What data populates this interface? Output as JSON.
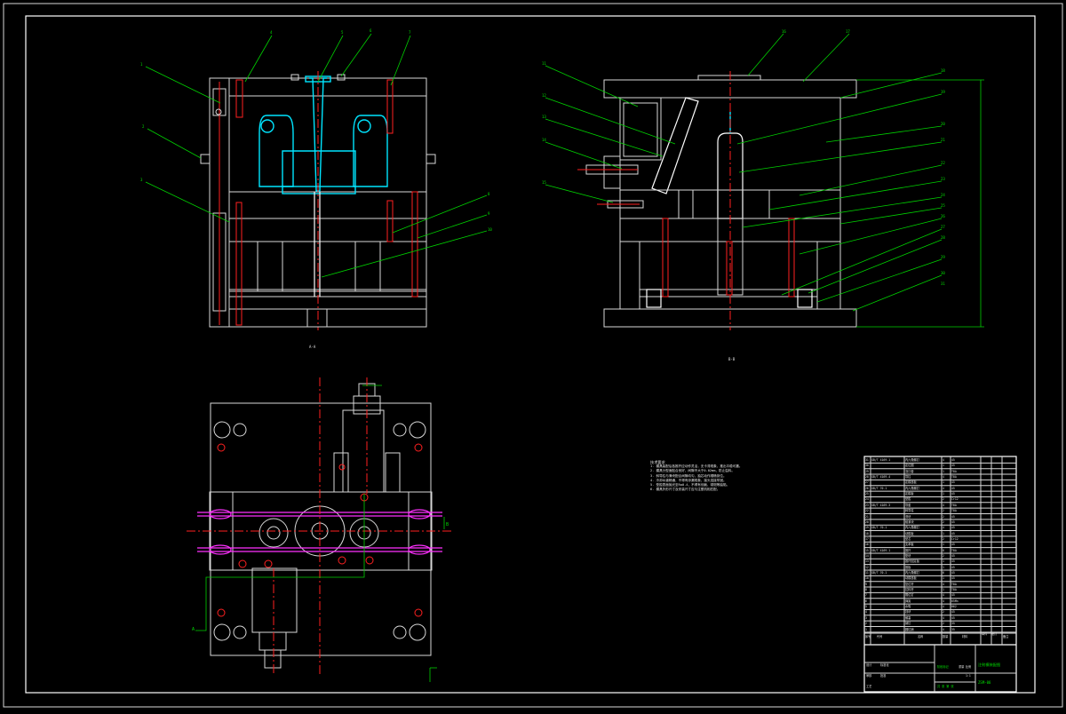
{
  "colors": {
    "background": "#000000",
    "outline": "#d8d8d8",
    "hatch": "#00b4b4",
    "insert": "#00e5ff",
    "leader": "#00d000",
    "centerline": "#ff2020",
    "highlight": "#ff30ff"
  },
  "views": {
    "left_section_label": "A-A",
    "right_section_label": "B-B",
    "left_balloons": [
      "1",
      "2",
      "3",
      "4",
      "5",
      "6",
      "7",
      "8",
      "9",
      "10"
    ],
    "right_balloons": [
      "11",
      "12",
      "13",
      "14",
      "15",
      "16",
      "17",
      "18",
      "19",
      "20",
      "21",
      "22",
      "23",
      "24",
      "25",
      "26",
      "27",
      "28",
      "29",
      "30",
      "31"
    ],
    "plan_view_marks": [
      "A",
      "B"
    ]
  },
  "technical_requirements": {
    "title": "技术要求",
    "items": [
      "1. 模具装配后各推杆应动作灵活，无卡滞现象，推出平稳可靠。",
      "2. 模具分型面贴合良好，间隙不大于0.02mm，防止溢料。",
      "3. 斜导柱与滑块配合间隙均匀，抽芯动作顺畅到位。",
      "4. 冷却水道畅通，不得有渗漏现象，接头连接牢固。",
      "5. 型腔表面抛光至Ra0.4，不得有划痕、锈斑等缺陷。",
      "6. 模具外形尺寸及安装尺寸应与注塑机相匹配。"
    ]
  },
  "bom": {
    "headers": [
      "序号",
      "代号",
      "名称",
      "数量",
      "材料",
      "单件",
      "总计",
      "备注"
    ],
    "rows": [
      [
        "31",
        "GB/T 4169.1",
        "内六角螺钉",
        "4",
        "45",
        "",
        "",
        ""
      ],
      [
        "30",
        "",
        "定位圈",
        "1",
        "45",
        "",
        "",
        ""
      ],
      [
        "29",
        "",
        "浇口套",
        "1",
        "T8A",
        "",
        "",
        ""
      ],
      [
        "28",
        "GB/T 4169.4",
        "导柱",
        "4",
        "T8A",
        "",
        "",
        ""
      ],
      [
        "27",
        "",
        "定模座板",
        "1",
        "45",
        "",
        "",
        ""
      ],
      [
        "26",
        "GB/T 70.1",
        "内六角螺钉",
        "4",
        "45",
        "",
        "",
        ""
      ],
      [
        "25",
        "",
        "定模板",
        "1",
        "45",
        "",
        "",
        ""
      ],
      [
        "24",
        "",
        "型腔",
        "2",
        "Cr12",
        "",
        "",
        ""
      ],
      [
        "23",
        "GB/T 4169.3",
        "导套",
        "4",
        "T8A",
        "",
        "",
        ""
      ],
      [
        "22",
        "",
        "斜导柱",
        "2",
        "T8A",
        "",
        "",
        ""
      ],
      [
        "21",
        "",
        "滑块",
        "2",
        "45",
        "",
        "",
        ""
      ],
      [
        "20",
        "",
        "楔紧块",
        "2",
        "45",
        "",
        "",
        ""
      ],
      [
        "19",
        "GB/T 70.1",
        "内六角螺钉",
        "4",
        "45",
        "",
        "",
        ""
      ],
      [
        "18",
        "",
        "动模板",
        "1",
        "45",
        "",
        "",
        ""
      ],
      [
        "17",
        "",
        "型芯",
        "2",
        "Cr12",
        "",
        "",
        ""
      ],
      [
        "16",
        "",
        "支承板",
        "1",
        "45",
        "",
        "",
        ""
      ],
      [
        "15",
        "GB/T 4169.1",
        "推杆",
        "8",
        "T8A",
        "",
        "",
        ""
      ],
      [
        "14",
        "",
        "垫块",
        "2",
        "45",
        "",
        "",
        ""
      ],
      [
        "13",
        "",
        "推杆固定板",
        "1",
        "45",
        "",
        "",
        ""
      ],
      [
        "12",
        "",
        "推板",
        "1",
        "45",
        "",
        "",
        ""
      ],
      [
        "11",
        "GB/T 70.1",
        "内六角螺钉",
        "6",
        "45",
        "",
        "",
        ""
      ],
      [
        "10",
        "",
        "动模座板",
        "1",
        "45",
        "",
        "",
        ""
      ],
      [
        "9",
        "",
        "复位杆",
        "4",
        "T8A",
        "",
        "",
        ""
      ],
      [
        "8",
        "",
        "拉料杆",
        "1",
        "T8A",
        "",
        "",
        ""
      ],
      [
        "7",
        "",
        "限位钉",
        "4",
        "45",
        "",
        "",
        ""
      ],
      [
        "6",
        "",
        "弹簧",
        "4",
        "65Mn",
        "",
        "",
        ""
      ],
      [
        "5",
        "",
        "水嘴",
        "4",
        "H62",
        "",
        "",
        ""
      ],
      [
        "4",
        "",
        "挡块",
        "2",
        "45",
        "",
        "",
        ""
      ],
      [
        "3",
        "",
        "螺塞",
        "4",
        "45",
        "",
        "",
        ""
      ],
      [
        "2",
        "",
        "销钉",
        "2",
        "35",
        "",
        "",
        ""
      ],
      [
        "1",
        "",
        "圆柱销",
        "4",
        "35",
        "",
        "",
        ""
      ]
    ]
  },
  "title_block": {
    "drawing_title": "注射模装配图",
    "drawing_number": "ZSM-00",
    "scale_label": "比例",
    "scale": "1:1",
    "weight_label": "重量",
    "sheet_label": "共 张 第 张",
    "designer_label": "设计",
    "checker_label": "审核",
    "process_label": "工艺",
    "approve_label": "批准",
    "stage_label": "阶段标记",
    "std_label": "标准化"
  }
}
